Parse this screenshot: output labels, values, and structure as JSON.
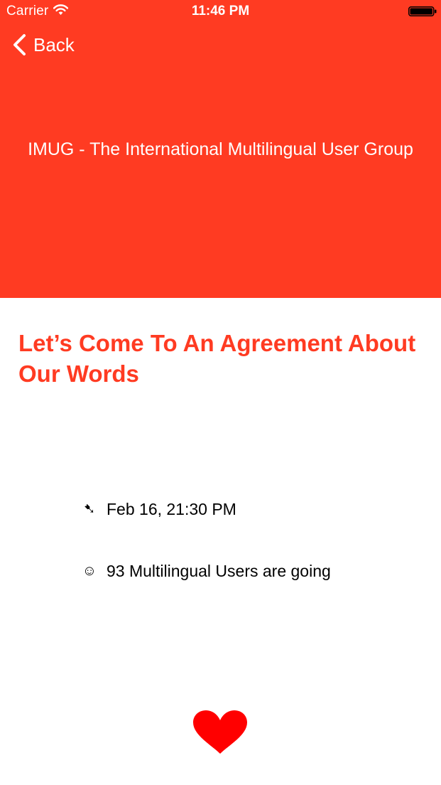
{
  "status_bar": {
    "carrier": "Carrier",
    "time": "11:46 PM",
    "wifi_icon": "wifi-icon",
    "battery_icon": "battery-full-icon"
  },
  "navigation": {
    "back_label": "Back",
    "back_icon": "chevron-left-icon"
  },
  "group": {
    "title": "IMUG - The International Multilingual User Group"
  },
  "event": {
    "title": "Let’s Come To An Agreement About Our Words",
    "date_icon": "➷",
    "date": "Feb 16, 21:30 PM",
    "attendees_icon": "☺",
    "attendees": "93 Multilingual Users are going"
  },
  "actions": {
    "favorite_icon": "heart-icon"
  },
  "colors": {
    "accent": "#ff3b22",
    "heart": "#ff0000",
    "background": "#ffffff",
    "header_text": "#ffffff",
    "body_text": "#000000"
  }
}
